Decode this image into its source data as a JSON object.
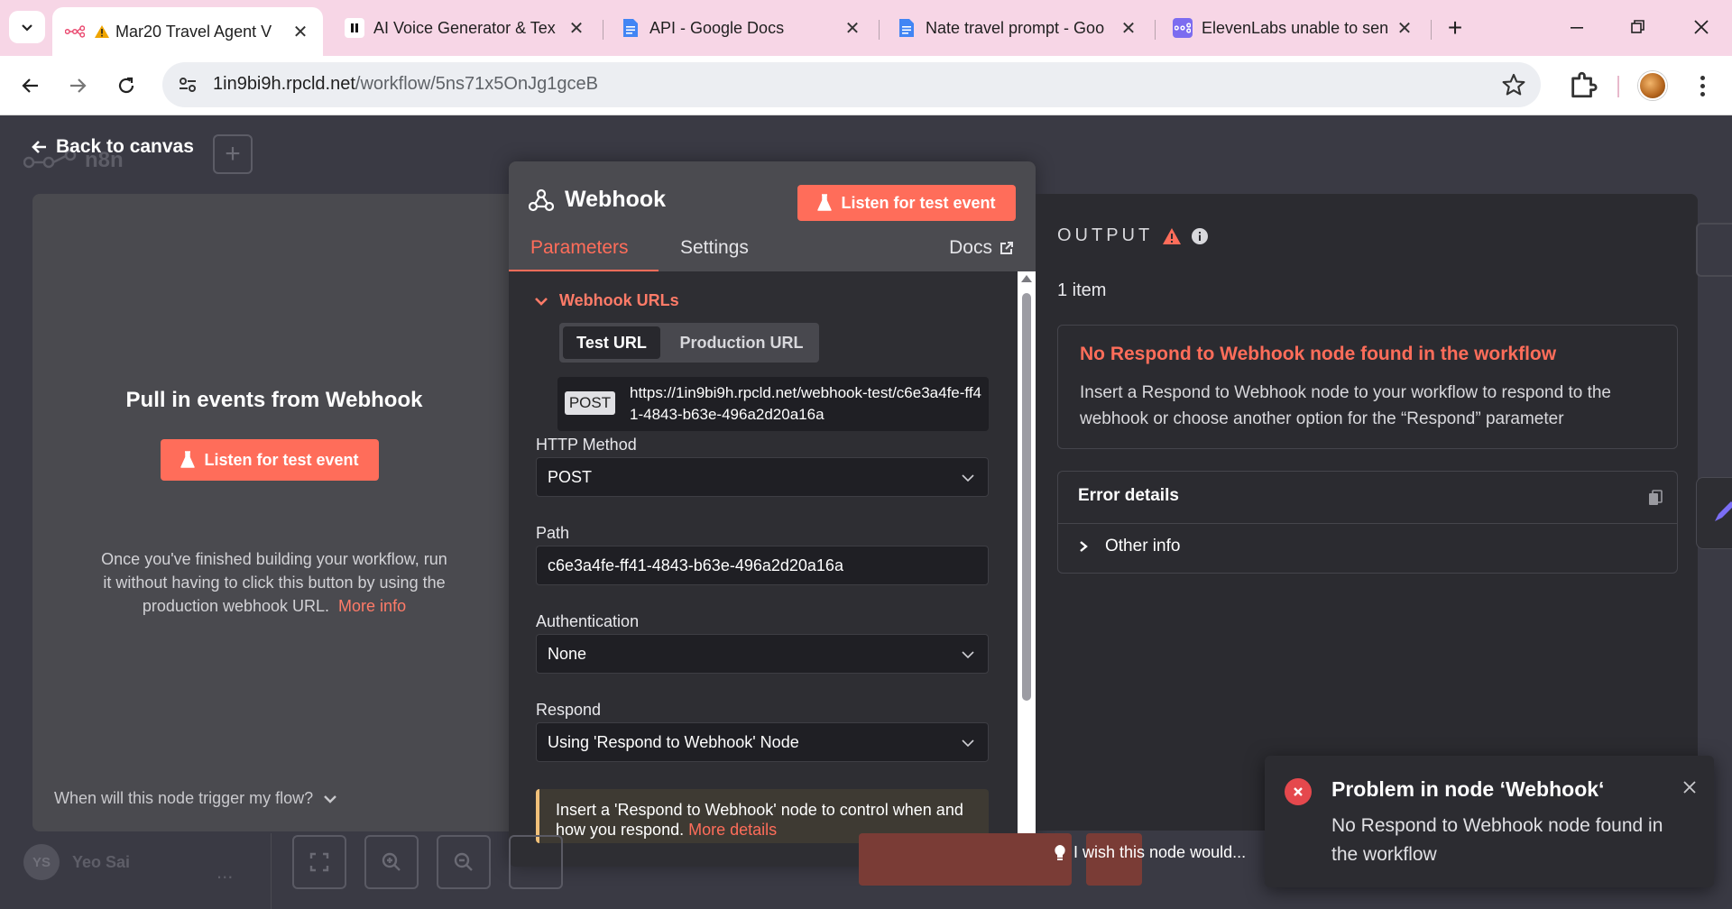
{
  "browser": {
    "tabs": [
      {
        "title": "Mar20 Travel Agent V",
        "icon": "n8n-logo-icon",
        "warning": true,
        "active": true
      },
      {
        "title": "AI Voice Generator & Tex",
        "icon": "pause-icon",
        "active": false
      },
      {
        "title": "API - Google Docs",
        "icon": "google-docs-icon",
        "active": false
      },
      {
        "title": "Nate travel prompt - Goo",
        "icon": "google-docs-icon",
        "active": false
      },
      {
        "title": "ElevenLabs unable to sen",
        "icon": "n8n-logo-icon",
        "active": false
      }
    ],
    "url_host": "1in9bi9h.rpcld.net",
    "url_path": "/workflow/5ns71x5OnJg1gceB"
  },
  "canvas": {
    "logo_text": "n8n",
    "back_label": "Back to canvas",
    "user_initials": "YS",
    "user_name": "Yeo Sai",
    "more_dots": "...",
    "wish_text": "I wish this node would..."
  },
  "input_panel": {
    "title": "Pull in events from Webhook",
    "listen_button": "Listen for test event",
    "hint": "Once you've finished building your workflow, run it without having to click this button by using the production webhook URL.",
    "hint_link": "More info",
    "trigger_question": "When will this node trigger my flow?"
  },
  "node_panel": {
    "title": "Webhook",
    "listen_button": "Listen for test event",
    "tabs": {
      "parameters": "Parameters",
      "settings": "Settings",
      "docs": "Docs"
    },
    "webhook_urls_label": "Webhook URLs",
    "url_toggle": {
      "test": "Test URL",
      "production": "Production URL"
    },
    "url_method": "POST",
    "test_url": "https://1in9bi9h.rpcld.net/webhook-test/c6e3a4fe-ff41-4843-b63e-496a2d20a16a",
    "http_method_label": "HTTP Method",
    "http_method_value": "POST",
    "path_label": "Path",
    "path_value": "c6e3a4fe-ff41-4843-b63e-496a2d20a16a",
    "auth_label": "Authentication",
    "auth_value": "None",
    "respond_label": "Respond",
    "respond_value": "Using 'Respond to Webhook' Node",
    "notice_text": "Insert a 'Respond to Webhook' node to control when and how you respond.",
    "notice_link": "More details"
  },
  "output_panel": {
    "title": "OUTPUT",
    "item_count": "1 item",
    "error_title": "No Respond to Webhook node found in the workflow",
    "error_desc": "Insert a Respond to Webhook node to your workflow to respond to the webhook or choose another option for the “Respond” parameter",
    "details_title": "Error details",
    "other_info": "Other info"
  },
  "toast": {
    "title": "Problem in node ‘Webhook‘",
    "message": "No Respond to Webhook node found in the workflow"
  },
  "colors": {
    "accent": "#ff6d5a",
    "tabbar": "#f7d6e6",
    "panel_dark": "#2e2e33",
    "error_red": "#e5484d"
  }
}
